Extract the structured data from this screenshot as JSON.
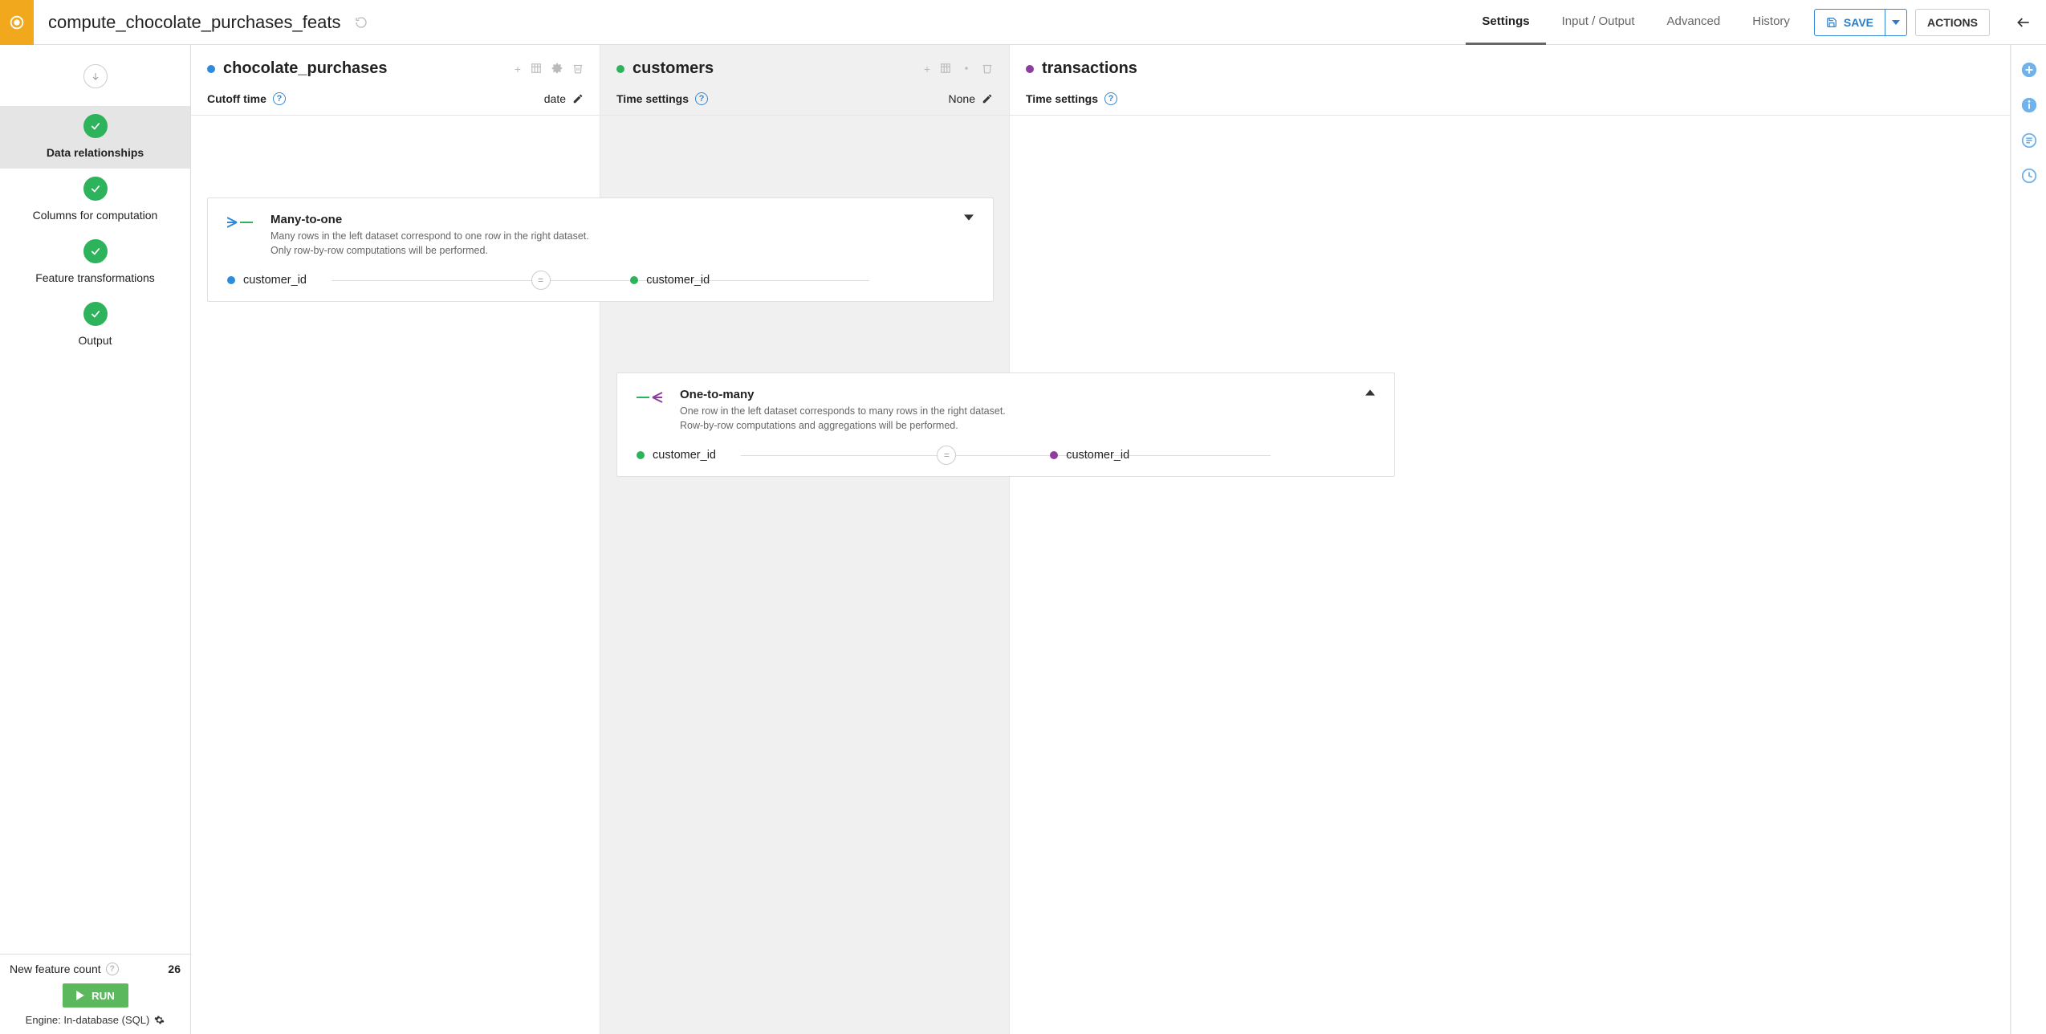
{
  "header": {
    "title": "compute_chocolate_purchases_feats",
    "tabs": {
      "settings": "Settings",
      "io": "Input / Output",
      "advanced": "Advanced",
      "history": "History"
    },
    "save_label": "SAVE",
    "actions_label": "ACTIONS"
  },
  "sidebar": {
    "steps": {
      "data_relationships": "Data relationships",
      "columns_computation": "Columns for computation",
      "feature_transformations": "Feature transformations",
      "output": "Output"
    },
    "feature_count_label": "New feature count",
    "feature_count_value": "26",
    "run_label": "RUN",
    "engine_label": "Engine: In-database (SQL)"
  },
  "datasets": {
    "chocolate": {
      "name": "chocolate_purchases",
      "cutoff_label": "Cutoff time",
      "cutoff_value": "date"
    },
    "customers": {
      "name": "customers",
      "time_label": "Time settings",
      "time_value": "None"
    },
    "transactions": {
      "name": "transactions",
      "time_label": "Time settings"
    }
  },
  "relationships": {
    "many_to_one": {
      "title": "Many-to-one",
      "desc1": "Many rows in the left dataset correspond to one row in the right dataset.",
      "desc2": "Only row-by-row computations will be performed.",
      "left_key": "customer_id",
      "right_key": "customer_id"
    },
    "one_to_many": {
      "title": "One-to-many",
      "desc1": "One row in the left dataset corresponds to many rows in the right dataset.",
      "desc2": "Row-by-row computations and aggregations will be performed.",
      "left_key": "customer_id",
      "right_key": "customer_id"
    }
  }
}
